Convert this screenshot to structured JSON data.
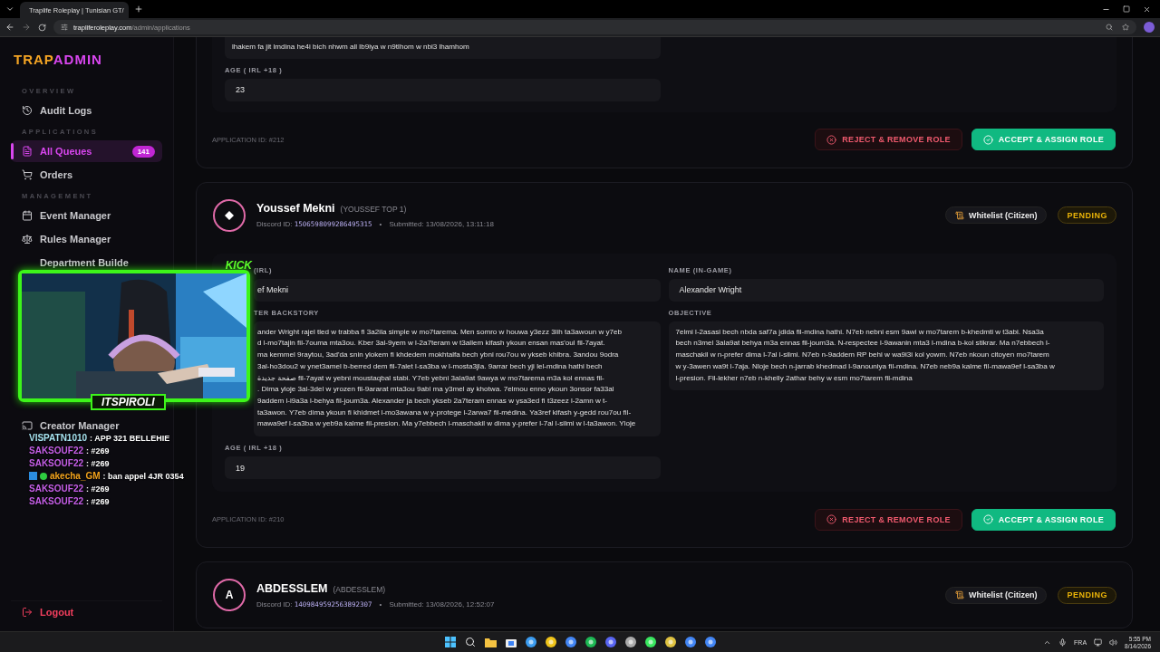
{
  "browser": {
    "tab_title": "Traplife Roleplay | Tunisian GT/",
    "url_host": "trapliferoleplay.com",
    "url_path": "/admin/applications"
  },
  "sidebar": {
    "logo": [
      {
        "text": "TRAP",
        "color": "#f5a524"
      },
      {
        "text": "ADMIN",
        "color": "#d946ef"
      }
    ],
    "sections": [
      {
        "title": "OVERVIEW",
        "items": [
          {
            "label": "Audit Logs",
            "selected": false
          }
        ]
      },
      {
        "title": "APPLICATIONS",
        "items": [
          {
            "label": "All Queues",
            "selected": true,
            "badge": "141"
          },
          {
            "label": "Orders",
            "selected": false
          }
        ]
      },
      {
        "title": "MANAGEMENT",
        "items": [
          {
            "label": "Event Manager",
            "selected": false
          },
          {
            "label": "Rules Manager",
            "selected": false
          },
          {
            "label": "Department Builde",
            "selected": false
          },
          {
            "label": "Creator Manager",
            "selected": false
          }
        ]
      }
    ],
    "logout": "Logout"
  },
  "applications": [
    {
      "partial": true,
      "left": [
        {
          "kind": "text",
          "covered": false,
          "lines": [
            "lhakem fa jit lmdina he4i bich nhwm all lb9iya w n9tlhom w nbi3 lhamhom"
          ]
        },
        {
          "kind": "value",
          "label": "AGE ( IRL +18 )",
          "value": "23",
          "covered": false
        }
      ],
      "app_id": "APPLICATION ID: #212",
      "reject": "REJECT & REMOVE ROLE",
      "accept": "ACCEPT & ASSIGN ROLE"
    },
    {
      "partial": false,
      "avatar": {
        "kind": "icon"
      },
      "name": "Youssef Mekni",
      "nick": "(YOUSSEF TOP 1)",
      "discord_label": "Discord ID:",
      "discord_id": "1506598099286495315",
      "dot": "•",
      "submitted": "Submitted: 13/08/2026, 13:11:18",
      "type": "Whitelist (Citizen)",
      "status": "PENDING",
      "left": [
        {
          "kind": "value",
          "label": "(IRL)",
          "value": "ef Mekni",
          "covered": true
        },
        {
          "kind": "text",
          "label": "TER BACKSTORY",
          "covered": true,
          "lines": [
            "ander Wright rajel tled w trabba fi 3a2ila simple w mo7tarema. Men somro w houwa y3ezz 3lih ta3awoun w y7eb",
            "d l-mo7tajin fil-7ouma mta3ou. Kber 3al-9yem w l-2a7teram w t3allem kifash ykoun ensan mas'oul fil-7ayat.",
            "ma kemmel 9raytou, 3ad'da snin ylokem fi khdedem mokhtalfa bech ybni rou7ou w ykseb khibra. 3andou 9odra",
            "3al-ho3dou2 w ynet3amel b-berred dem fil-7alet l-sa3ba w l-mosta3jla. 9arrar bech yji lel-mdina hathi bech",
            "صفحة جديدة fil-7ayat w yebni moustaqbal stabi. Y7eb yebni 3ala9at 9awya w mo7tarema m3a kol ennas fil-",
            ". Dima yloje 3al-3del w yrozen fil-9ararat mta3ou 9abl ma y3mel ay khotwa. 7elmou enno ykoun 3onsor fa33al",
            "9addem l-i9a3a l-behya fil-joum3a. Alexander ja bech ykseb 2a7teram ennas w ysa3ed fi t3zeez l-2amn w t-",
            "ta3awon. Y7eb dima ykoun fi khidmet l-mo3awana w y-protege l-2arwa7 fil-médina. Ya3ref kifash y-gedd rou7ou fil-",
            "mawa9ef l-sa3ba w yeb9a kalme fil-presion. Ma y7ebbech l-maschakil w dima y-prefer l-7al l-silmi w l-ta3awon. Yloje"
          ]
        },
        {
          "kind": "value",
          "label": "AGE ( IRL +18 )",
          "value": "19",
          "covered": false
        }
      ],
      "right": [
        {
          "kind": "value",
          "label": "NAME (IN-GAME)",
          "value": "Alexander Wright",
          "covered": false
        },
        {
          "kind": "text",
          "label": "OBJECTIVE",
          "covered": false,
          "lines": [
            "7elmi l-2asasi bech nbda saf7a jdida fil-mdina hathi. N7eb nebni esm 9awi w mo7tarem b-khedmti w t3abi. Nsa3a",
            "bech n3mel 3ala9at behya m3a ennas fil-joum3a. N-respectee l-9awanin mta3 l-mdina b-kol stikrar. Ma n7ebbech l-",
            "maschakil w n-prefer dima l-7al l-silmi. N7eb n-9addem RP behi w wa9i3i kol yowm. N7eb nkoun citoyen mo7tarem",
            "w y-3awen wa9t l-7aja. Nloje bech n-jarrab khedmad l-9anouniya fil-mdina. N7eb neb9a kalme fil-mawa9ef l-sa3ba w",
            "l-presion. Fil-lekher n7eb n-khelly 2athar behy w esm mo7tarem fil-mdina"
          ]
        }
      ],
      "app_id": "APPLICATION ID: #210",
      "reject": "REJECT & REMOVE ROLE",
      "accept": "ACCEPT & ASSIGN ROLE"
    },
    {
      "partial": false,
      "avatar": {
        "kind": "letter",
        "text": "A"
      },
      "name": "ABDESSLEM",
      "nick": "(ABDESSLEM)",
      "discord_label": "Discord ID:",
      "discord_id": "1409849592563892307",
      "dot": "•",
      "submitted": "Submitted: 13/08/2026, 12:52:07",
      "type": "Whitelist (Citizen)",
      "status": "PENDING"
    }
  ],
  "stream": {
    "streamer": "ITSPIROLI",
    "platform": "KICK",
    "chat": [
      {
        "user": "VISPATN1010",
        "text": ": APP 321 BELLEHIE",
        "color": "#a6e3f0",
        "badges": false
      },
      {
        "user": "SAKSOUF22",
        "text": ": #269",
        "color": "#c65fe8",
        "badges": false
      },
      {
        "user": "SAKSOUF22",
        "text": ": #269",
        "color": "#c65fe8",
        "badges": false
      },
      {
        "user": "akecha_GM",
        "text": ": ban appel 4JR 0354",
        "color": "#f0a21c",
        "badges": true
      },
      {
        "user": "SAKSOUF22",
        "text": ": #269",
        "color": "#c65fe8",
        "badges": false
      },
      {
        "user": "SAKSOUF22",
        "text": ": #269",
        "color": "#c65fe8",
        "badges": false
      }
    ]
  },
  "taskbar": {
    "language": "FRA",
    "time": "5:55 PM",
    "date": "8/14/2026"
  }
}
